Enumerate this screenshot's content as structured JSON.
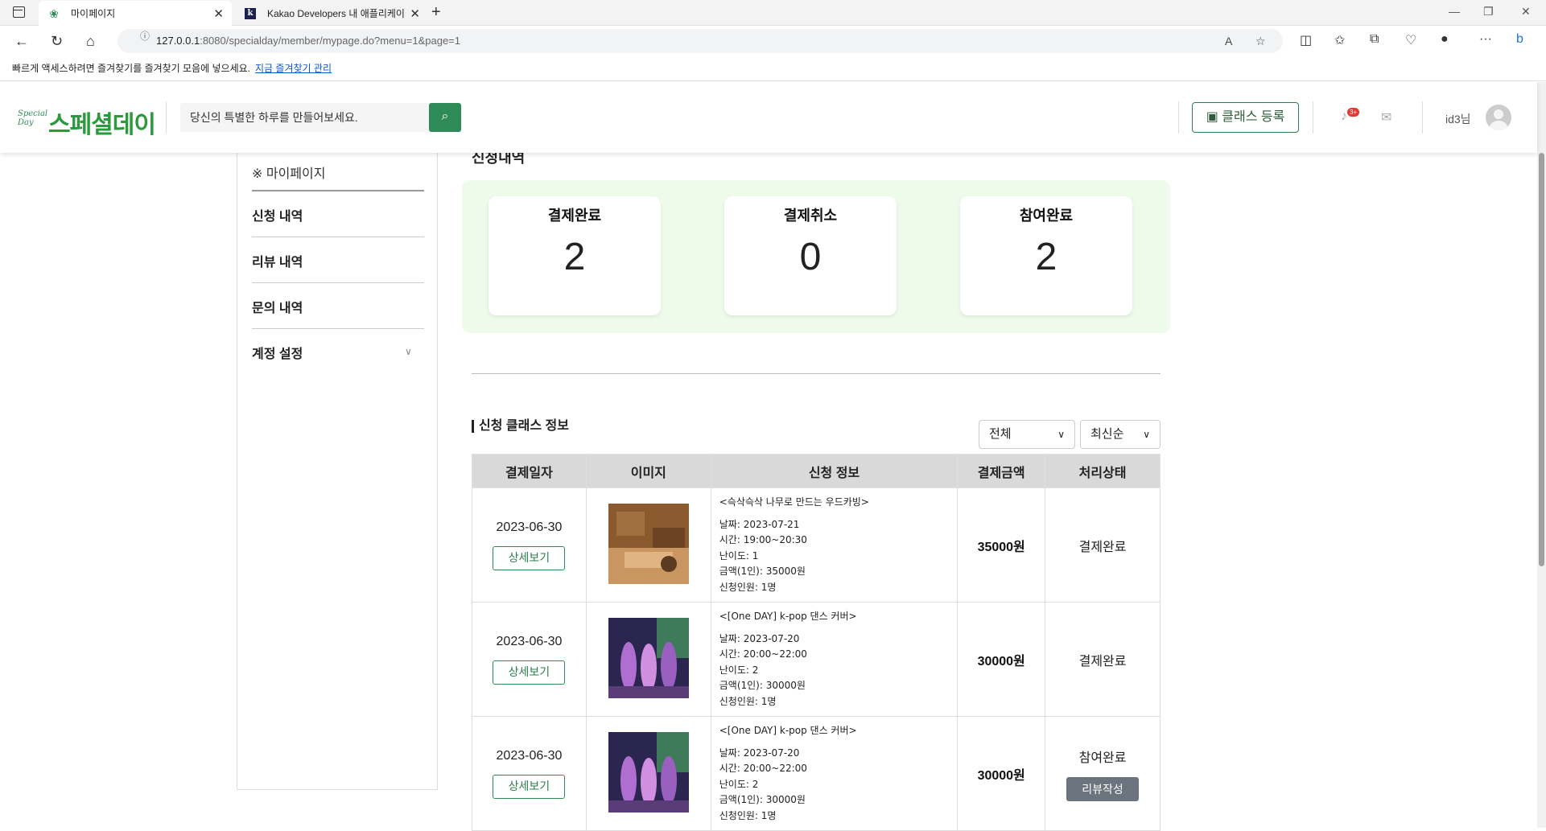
{
  "browser": {
    "tab1_title": "마이페이지",
    "tab2_title": "Kakao Developers 내 애플리케이",
    "url_host": "127.0.0.1",
    "url_path": ":8080/specialday/member/mypage.do?menu=1&page=1",
    "favbar_text": "빠르게 액세스하려면 즐겨찾기를 즐겨찾기 모음에 넣으세요.",
    "favbar_link": "지금 즐겨찾기 관리"
  },
  "header": {
    "logo_mark": "Special Day",
    "logo_text": "스페셜데이",
    "search_placeholder": "당신의 특별한 하루를 만들어보세요.",
    "register_label": "클래스 등록",
    "notif_badge": "3+",
    "user_label": "id3님"
  },
  "sidebar": {
    "title": "※ 마이페이지",
    "items": [
      {
        "label": "신청 내역"
      },
      {
        "label": "리뷰 내역"
      },
      {
        "label": "문의 내역"
      },
      {
        "label": "계정 설정"
      }
    ]
  },
  "main": {
    "page_title": "신청내역",
    "stats": [
      {
        "label": "결제완료",
        "value": "2"
      },
      {
        "label": "결제취소",
        "value": "0"
      },
      {
        "label": "참여완료",
        "value": "2"
      }
    ],
    "section_title": "신청 클래스 정보",
    "filter_selected": "전체",
    "sort_selected": "최신순",
    "columns": [
      "결제일자",
      "이미지",
      "신청 정보",
      "결제금액",
      "처리상태"
    ],
    "detail_label": "상세보기",
    "review_label": "리뷰작성",
    "rows": [
      {
        "date": "2023-06-30",
        "title": "<슥삭슥삭 나무로 만드는 우드카빙>",
        "d": "날짜: 2023-07-21",
        "t": "시간: 19:00~20:30",
        "lv": "난이도: 1",
        "price": "금액(1인): 35000원",
        "ppl": "신청인원: 1명",
        "amount": "35000원",
        "status": "결제완료"
      },
      {
        "date": "2023-06-30",
        "title": "<[One DAY] k-pop 댄스 커버>",
        "d": "날짜: 2023-07-20",
        "t": "시간: 20:00~22:00",
        "lv": "난이도: 2",
        "price": "금액(1인): 30000원",
        "ppl": "신청인원: 1명",
        "amount": "30000원",
        "status": "결제완료"
      },
      {
        "date": "2023-06-30",
        "title": "<[One DAY] k-pop 댄스 커버>",
        "d": "날짜: 2023-07-20",
        "t": "시간: 20:00~22:00",
        "lv": "난이도: 2",
        "price": "금액(1인): 30000원",
        "ppl": "신청인원: 1명",
        "amount": "30000원",
        "status": "참여완료"
      }
    ]
  },
  "colors": {
    "brand_green": "#2e8b57",
    "panel_bg": "#eefbea"
  }
}
